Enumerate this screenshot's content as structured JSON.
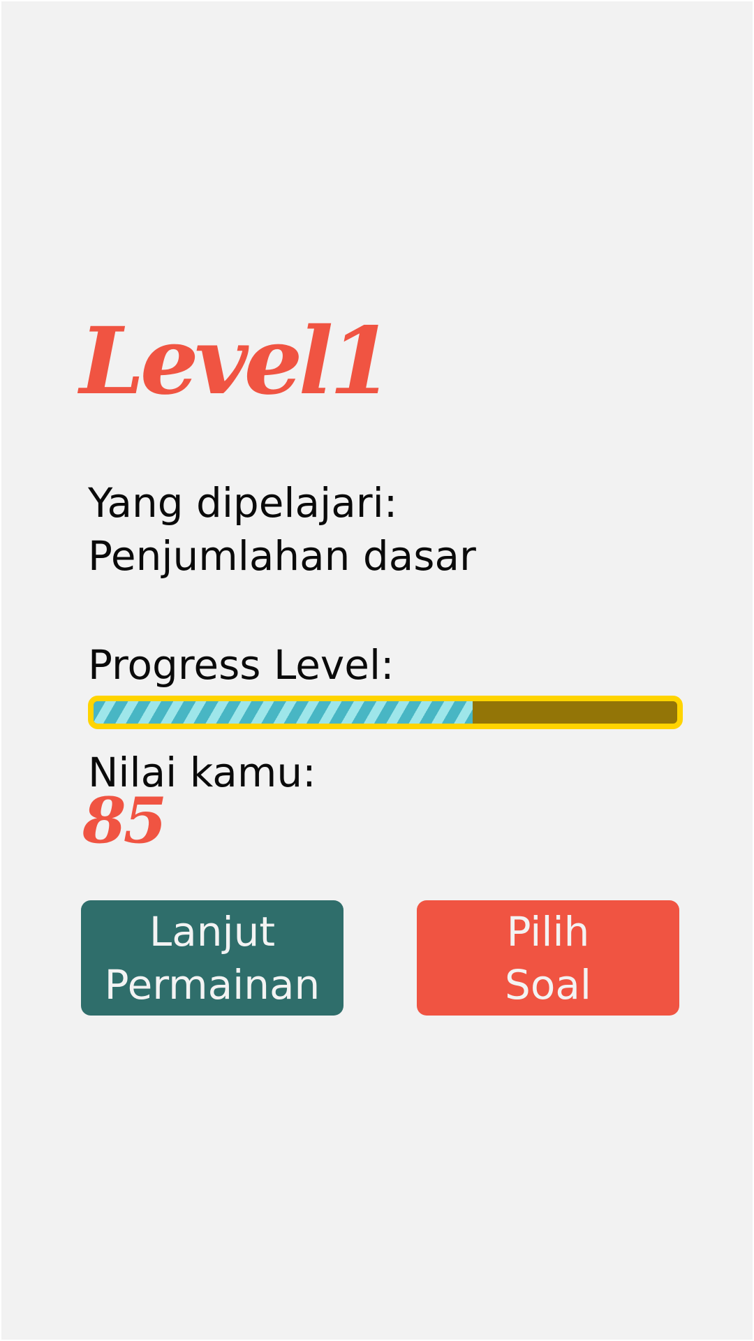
{
  "header": {
    "level_title": "Level1"
  },
  "lesson": {
    "learned_label": "Yang dipelajari:",
    "learned_value": "Penjumlahan dasar"
  },
  "progress": {
    "label": "Progress Level:",
    "value": 0.65,
    "fill_color": "#48b6c4",
    "stripe_color": "#9ee6ea",
    "border_color": "#ffd400",
    "track_color": "#937507"
  },
  "score": {
    "label": "Nilai kamu:",
    "value": "85"
  },
  "buttons": {
    "continue_line1": "Lanjut",
    "continue_line2": "Permainan",
    "continue_color": "#2f6e6b",
    "choose_line1": "Pilih",
    "choose_line2": "Soal",
    "choose_color": "#f05442"
  },
  "colors": {
    "accent": "#f05442",
    "background": "#f2f2f2"
  }
}
